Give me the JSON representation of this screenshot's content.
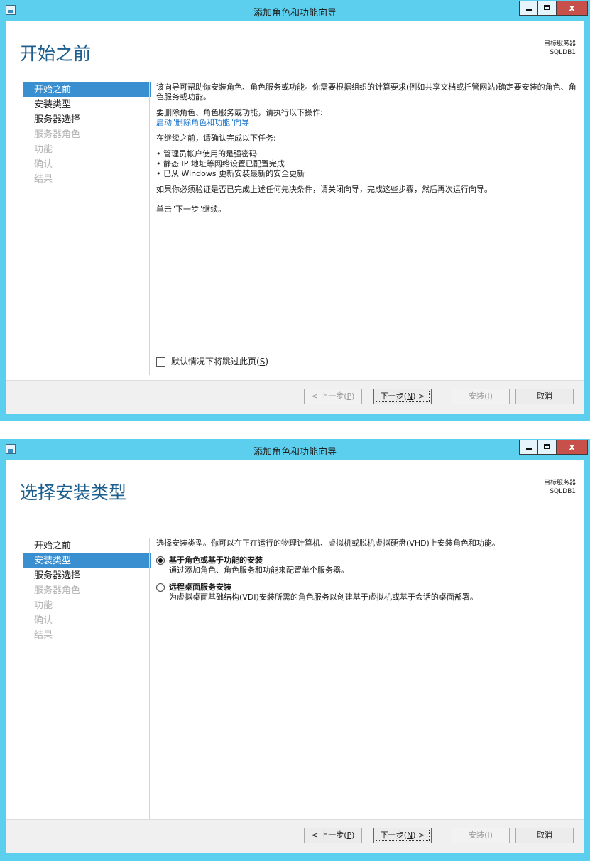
{
  "colors": {
    "title_bar": "#5ccfee",
    "accent": "#3a8fd0",
    "heading": "#1c5e8e",
    "close": "#c7504a"
  },
  "wizard1": {
    "window_title": "添加角色和功能向导",
    "close_glyph": "x",
    "page_title": "开始之前",
    "target_label": "目标服务器",
    "target_server": "SQLDB1",
    "nav": [
      {
        "label": "开始之前",
        "state": "active"
      },
      {
        "label": "安装类型",
        "state": "normal"
      },
      {
        "label": "服务器选择",
        "state": "normal"
      },
      {
        "label": "服务器角色",
        "state": "disabled"
      },
      {
        "label": "功能",
        "state": "disabled"
      },
      {
        "label": "确认",
        "state": "disabled"
      },
      {
        "label": "结果",
        "state": "disabled"
      }
    ],
    "intro": "该向导可帮助你安装角色、角色服务或功能。你需要根据组织的计算要求(例如共享文档或托管网站)确定要安装的角色、角色服务或功能。",
    "remove_text": "要删除角色、角色服务或功能，请执行以下操作:",
    "remove_link": "启动\"删除角色和功能\"向导",
    "confirm_text": "在继续之前，请确认完成以下任务:",
    "tasks": [
      "管理员帐户使用的是强密码",
      "静态 IP 地址等网络设置已配置完成",
      "已从 Windows 更新安装最新的安全更新"
    ],
    "verify_text": "如果你必须验证是否已完成上述任何先决条件，请关闭向导，完成这些步骤，然后再次运行向导。",
    "continue_text": "单击\"下一步\"继续。",
    "skip_label_prefix": "默认情况下将跳过此页(",
    "skip_label_key": "S",
    "skip_label_suffix": ")",
    "buttons": {
      "back_prefix": "< 上一步(",
      "back_key": "P",
      "back_suffix": ")",
      "next_prefix": "下一步(",
      "next_key": "N",
      "next_suffix": ") >",
      "install": "安装(I)",
      "cancel": "取消"
    }
  },
  "wizard2": {
    "window_title": "添加角色和功能向导",
    "close_glyph": "x",
    "page_title": "选择安装类型",
    "target_label": "目标服务器",
    "target_server": "SQLDB1",
    "nav": [
      {
        "label": "开始之前",
        "state": "normal"
      },
      {
        "label": "安装类型",
        "state": "active"
      },
      {
        "label": "服务器选择",
        "state": "normal"
      },
      {
        "label": "服务器角色",
        "state": "disabled"
      },
      {
        "label": "功能",
        "state": "disabled"
      },
      {
        "label": "确认",
        "state": "disabled"
      },
      {
        "label": "结果",
        "state": "disabled"
      }
    ],
    "intro": "选择安装类型。你可以在正在运行的物理计算机、虚拟机或脱机虚拟硬盘(VHD)上安装角色和功能。",
    "options": [
      {
        "title": "基于角色或基于功能的安装",
        "desc": "通过添加角色、角色服务和功能来配置单个服务器。",
        "selected": true
      },
      {
        "title": "远程桌面服务安装",
        "desc": "为虚拟桌面基础结构(VDI)安装所需的角色服务以创建基于虚拟机或基于会话的桌面部署。",
        "selected": false
      }
    ],
    "buttons": {
      "back_prefix": "< 上一步(",
      "back_key": "P",
      "back_suffix": ")",
      "next_prefix": "下一步(",
      "next_key": "N",
      "next_suffix": ") >",
      "install": "安装(I)",
      "cancel": "取消"
    }
  }
}
